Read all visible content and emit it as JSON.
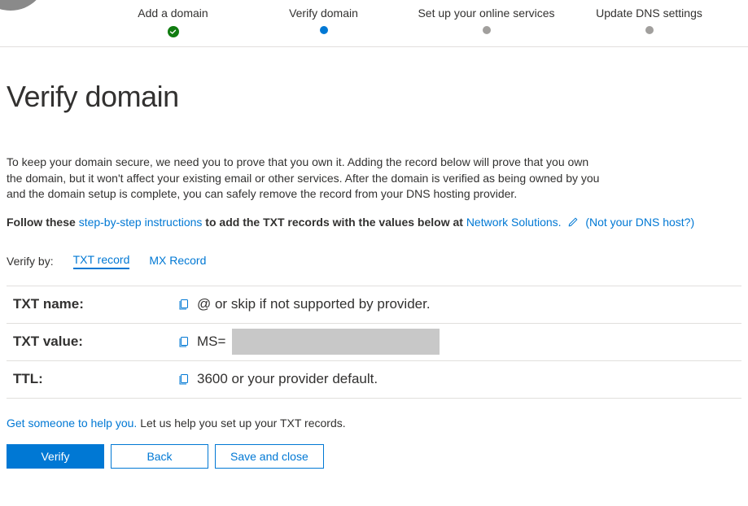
{
  "stepper": {
    "steps": [
      {
        "label": "Add a domain",
        "state": "complete"
      },
      {
        "label": "Verify domain",
        "state": "current"
      },
      {
        "label": "Set up your online services",
        "state": "future"
      },
      {
        "label": "Update DNS settings",
        "state": "future"
      }
    ]
  },
  "page": {
    "title": "Verify domain",
    "description": "To keep your domain secure, we need you to prove that you own it. Adding the record below will prove that you own the domain, but it won't affect your existing email or other services. After the domain is verified as being owned by you and the domain setup is complete, you can safely remove the record from your DNS hosting provider."
  },
  "follow": {
    "prefix": "Follow these ",
    "link1": "step-by-step instructions",
    "mid": " to add the TXT records with the values below at ",
    "provider": "Network Solutions.",
    "not_host": "(Not your DNS host?)"
  },
  "verify_by": {
    "label": "Verify by:",
    "tabs": [
      {
        "label": "TXT record",
        "active": true
      },
      {
        "label": "MX Record",
        "active": false
      }
    ]
  },
  "records": {
    "txt_name": {
      "label": "TXT name:",
      "value": "@ or skip if not supported by provider."
    },
    "txt_value": {
      "label": "TXT value:",
      "value_prefix": "MS="
    },
    "ttl": {
      "label": "TTL:",
      "value": "3600 or your provider default."
    }
  },
  "help": {
    "link": "Get someone to help you.",
    "text": " Let us help you set up your TXT records."
  },
  "buttons": {
    "verify": "Verify",
    "back": "Back",
    "save_close": "Save and close"
  }
}
